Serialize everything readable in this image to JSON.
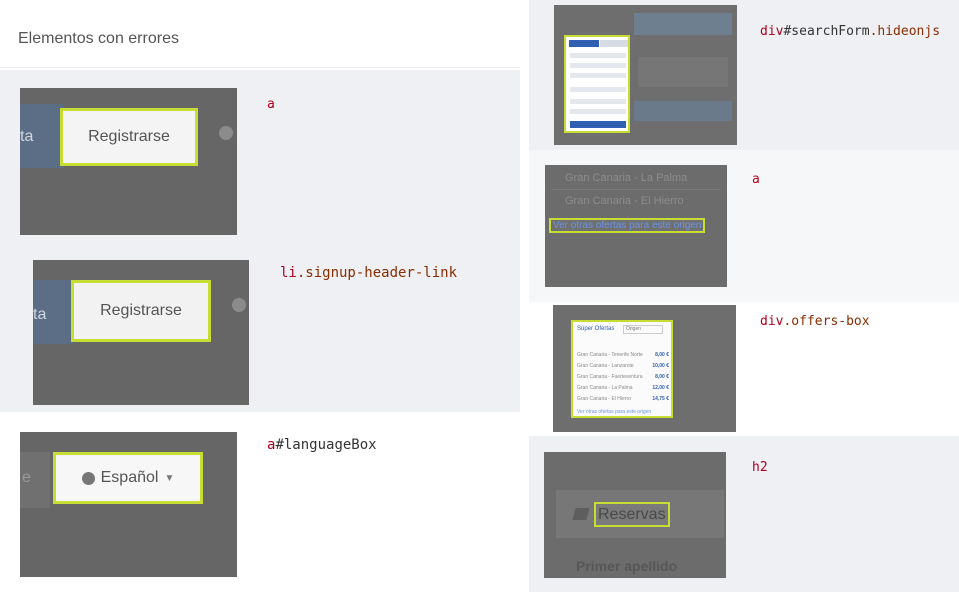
{
  "left_panel": {
    "title": "Elementos con errores",
    "items": [
      {
        "selector_tag": "a",
        "selector_rest": "",
        "preview": {
          "partial_text": "ta",
          "button_text": "Registrarse"
        }
      },
      {
        "selector_tag": "li",
        "selector_rest": ".signup-header-link",
        "preview": {
          "partial_text": "ta",
          "button_text": "Registrarse"
        }
      },
      {
        "selector_tag": "a",
        "selector_rest": "#languageBox",
        "preview": {
          "partial_text": "e",
          "button_text": "Español"
        }
      }
    ]
  },
  "right_panel": {
    "items": [
      {
        "selector_tag": "div",
        "selector_id": "#searchForm",
        "selector_class": ".hideonjs"
      },
      {
        "selector_tag": "a",
        "preview": {
          "list": [
            "Gran Canaria - La Palma",
            "Gran Canaria - El Hierro"
          ],
          "link_text": "Ver otras ofertas para este origen"
        }
      },
      {
        "selector_tag": "div",
        "selector_rest": ".offers-box",
        "preview": {
          "title": "Súper Ofertas",
          "select": "Origen",
          "rows": [
            {
              "route": "Gran Canaria - Tenerife Norte",
              "price": "8,00 €"
            },
            {
              "route": "Gran Canaria - Lanzarote",
              "price": "10,00 €"
            },
            {
              "route": "Gran Canaria - Fuerteventura",
              "price": "8,00 €"
            },
            {
              "route": "Gran Canaria - La Palma",
              "price": "12,00 €"
            },
            {
              "route": "Gran Canaria - El Hierro",
              "price": "14,75 €"
            }
          ],
          "more": "Ver otras ofertas para este origen"
        }
      },
      {
        "selector_tag": "h2",
        "preview": {
          "heading": "Reservas",
          "below": "Primer apellido"
        }
      }
    ]
  },
  "colors": {
    "highlight": "#c8dd33",
    "selector_tag": "#b0001e",
    "overlay": "#666666"
  }
}
